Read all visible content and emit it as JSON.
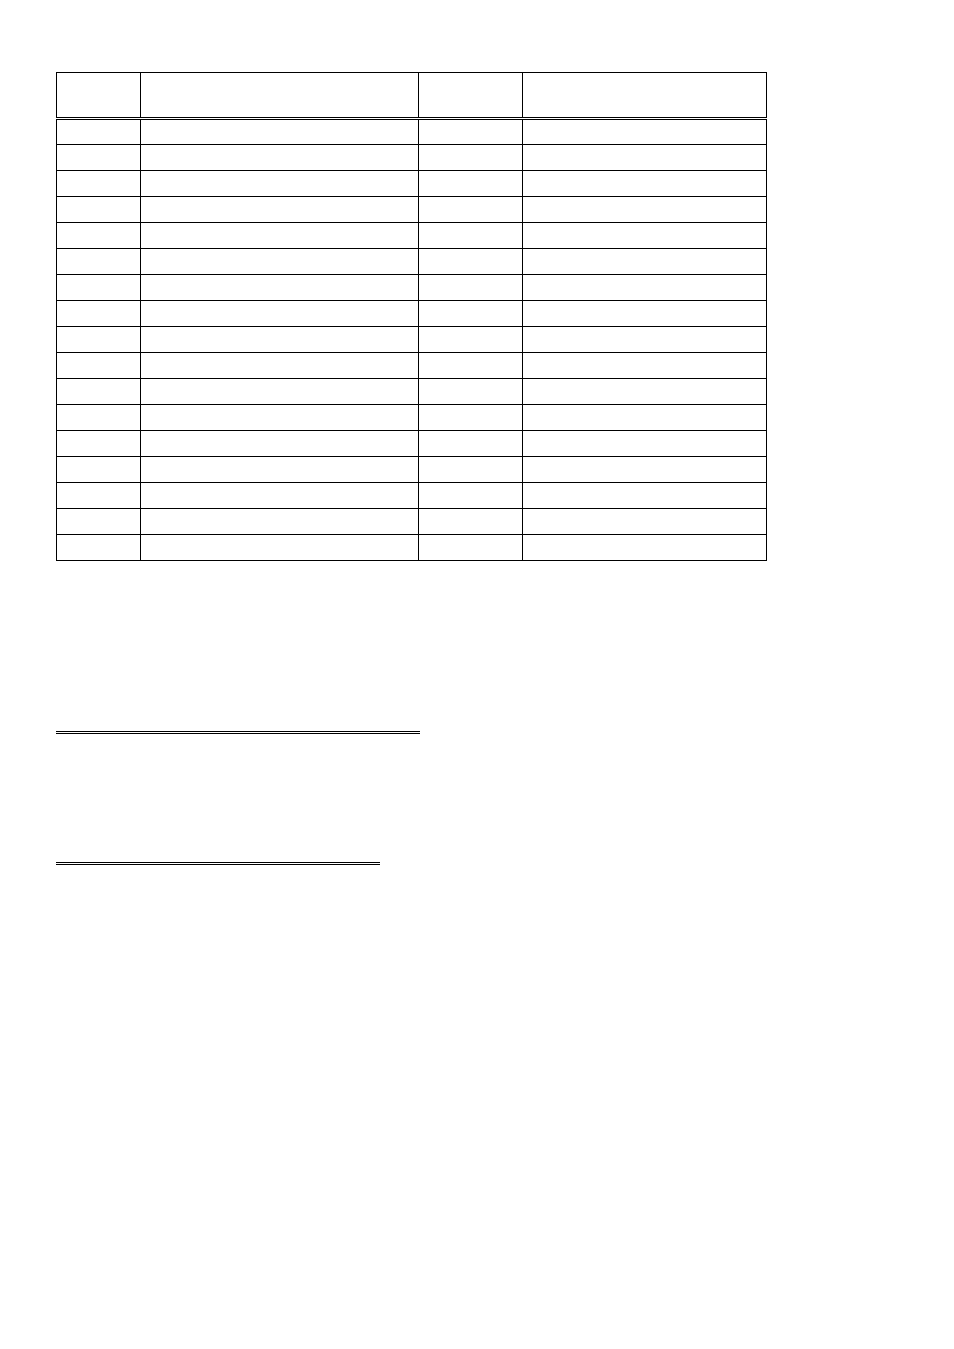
{
  "table": {
    "columns": [
      "",
      "",
      "",
      ""
    ],
    "rows": [
      [
        "",
        "",
        "",
        ""
      ],
      [
        "",
        "",
        "",
        ""
      ],
      [
        "",
        "",
        "",
        ""
      ],
      [
        "",
        "",
        "",
        ""
      ],
      [
        "",
        "",
        "",
        ""
      ],
      [
        "",
        "",
        "",
        ""
      ],
      [
        "",
        "",
        "",
        ""
      ],
      [
        "",
        "",
        "",
        ""
      ],
      [
        "",
        "",
        "",
        ""
      ],
      [
        "",
        "",
        "",
        ""
      ],
      [
        "",
        "",
        "",
        ""
      ],
      [
        "",
        "",
        "",
        ""
      ],
      [
        "",
        "",
        "",
        ""
      ],
      [
        "",
        "",
        "",
        ""
      ],
      [
        "",
        "",
        "",
        ""
      ],
      [
        "",
        "",
        "",
        ""
      ],
      [
        "",
        "",
        "",
        ""
      ]
    ]
  },
  "chart_data": {
    "type": "table",
    "columns": [
      "",
      "",
      "",
      ""
    ],
    "rows": [
      [
        "",
        "",
        "",
        ""
      ],
      [
        "",
        "",
        "",
        ""
      ],
      [
        "",
        "",
        "",
        ""
      ],
      [
        "",
        "",
        "",
        ""
      ],
      [
        "",
        "",
        "",
        ""
      ],
      [
        "",
        "",
        "",
        ""
      ],
      [
        "",
        "",
        "",
        ""
      ],
      [
        "",
        "",
        "",
        ""
      ],
      [
        "",
        "",
        "",
        ""
      ],
      [
        "",
        "",
        "",
        ""
      ],
      [
        "",
        "",
        "",
        ""
      ],
      [
        "",
        "",
        "",
        ""
      ],
      [
        "",
        "",
        "",
        ""
      ],
      [
        "",
        "",
        "",
        ""
      ],
      [
        "",
        "",
        "",
        ""
      ],
      [
        "",
        "",
        "",
        ""
      ],
      [
        "",
        "",
        "",
        ""
      ]
    ]
  }
}
